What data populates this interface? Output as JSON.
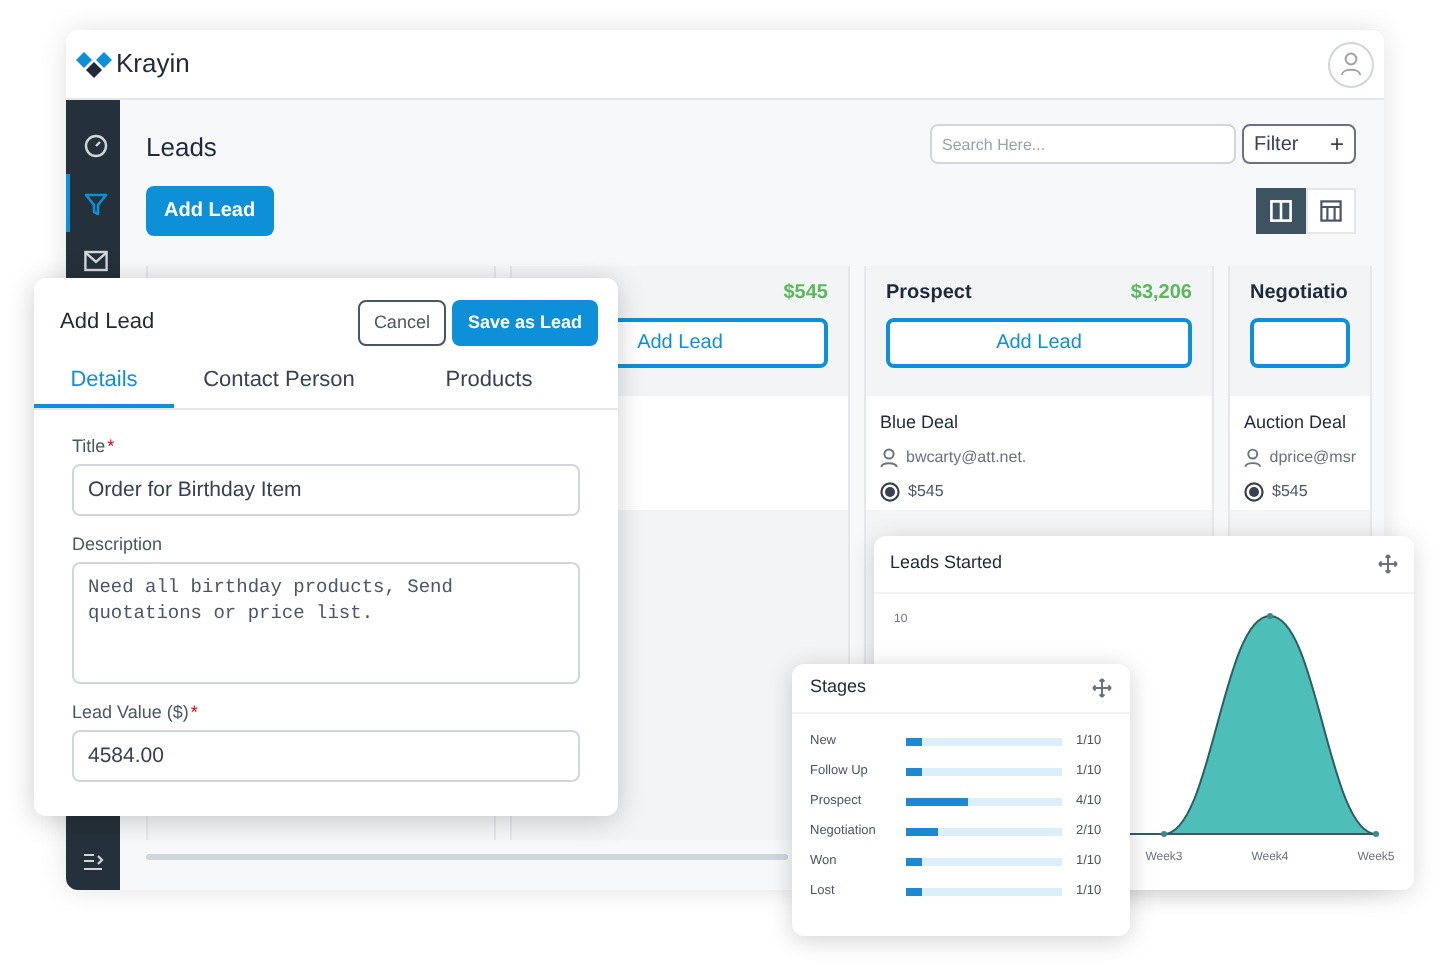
{
  "app": {
    "brand": "Krayin"
  },
  "sidebar": {
    "items": [
      {
        "kind": "gauge",
        "selected": false
      },
      {
        "kind": "funnel",
        "selected": true
      },
      {
        "kind": "mail",
        "selected": false
      }
    ]
  },
  "page": {
    "title": "Leads",
    "add_button": "Add Lead",
    "search": {
      "placeholder": "Search Here..."
    },
    "filter_button": "Filter",
    "filter_icon": "+",
    "views": [
      {
        "kind": "kanban",
        "selected": true
      },
      {
        "kind": "table",
        "selected": false
      }
    ]
  },
  "board": {
    "columns": [
      {
        "kind": "blank"
      },
      {
        "kind": "stage",
        "amount": "$545",
        "button": "Add Lead"
      },
      {
        "kind": "stage",
        "name": "Prospect",
        "amount": "$3,206",
        "button": "Add Lead",
        "cards": [
          {
            "title": "Blue Deal",
            "contact": "bwcarty@att.net.",
            "value": "$545"
          }
        ]
      },
      {
        "kind": "stage",
        "name": "Negotiatio",
        "cards": [
          {
            "title": "Auction Deal",
            "contact": "dprice@msr",
            "value": "$545"
          }
        ]
      }
    ]
  },
  "dialog": {
    "title": "Add Lead",
    "cancel": "Cancel",
    "save": "Save as Lead",
    "tabs": [
      {
        "label": "Details",
        "selected": true
      },
      {
        "label": "Contact Person",
        "selected": false
      },
      {
        "label": "Products",
        "selected": false
      }
    ],
    "fields": [
      {
        "kind": "input",
        "label": "Title",
        "required_mark": "*",
        "value": "Order for Birthday Item"
      },
      {
        "kind": "textarea",
        "label": "Description",
        "value": "Need all birthday products, Send quotations or price list."
      },
      {
        "kind": "input",
        "label": "Lead Value ($)",
        "required_mark": "*",
        "value": "4584.00"
      }
    ]
  },
  "leads_started": {
    "title": "Leads Started",
    "y_label": "10",
    "x_labels": [
      "Week3",
      "Week4",
      "Week5"
    ]
  },
  "stages": {
    "title": "Stages",
    "rows": [
      {
        "name": "New",
        "level": 0.1,
        "reading": "1/10"
      },
      {
        "name": "Follow Up",
        "level": 0.1,
        "reading": "1/10"
      },
      {
        "name": "Prospect",
        "level": 0.4,
        "reading": "4/10"
      },
      {
        "name": "Negotiation",
        "level": 0.2,
        "reading": "2/10"
      },
      {
        "name": "Won",
        "level": 0.1,
        "reading": "1/10"
      },
      {
        "name": "Lost",
        "level": 0.1,
        "reading": "1/10"
      }
    ]
  }
}
